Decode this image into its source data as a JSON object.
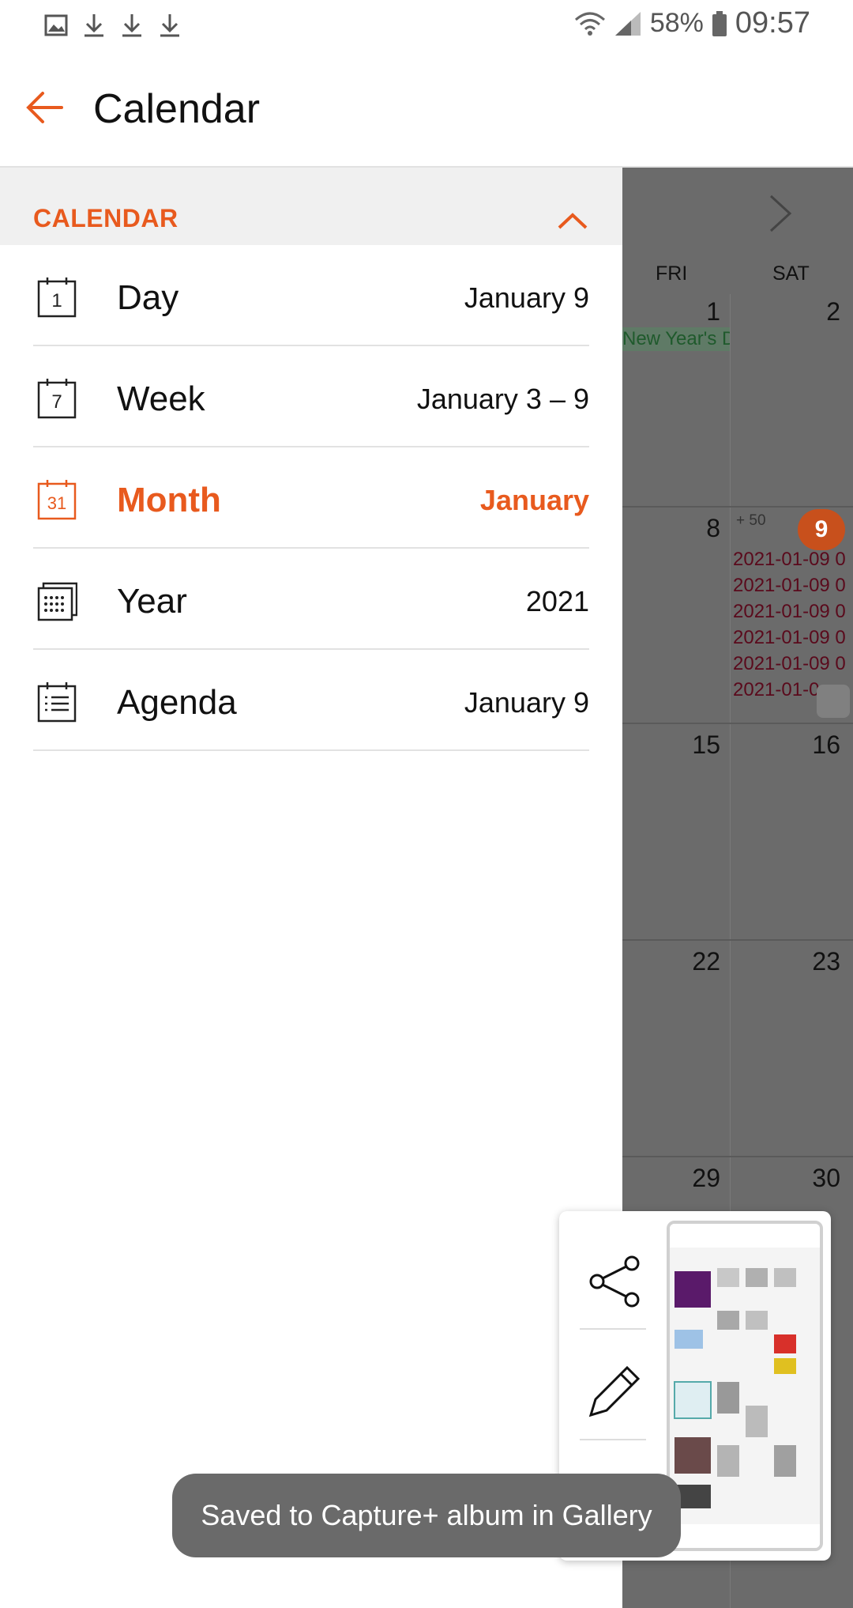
{
  "status_bar": {
    "icons_left": [
      "gallery-icon",
      "download-icon",
      "download-icon",
      "download-icon"
    ],
    "battery_percent": "58%",
    "time": "09:57"
  },
  "app_bar": {
    "title": "Calendar"
  },
  "drawer": {
    "section_title": "CALENDAR",
    "items": [
      {
        "label": "Day",
        "value": "January 9",
        "icon_text": "1"
      },
      {
        "label": "Week",
        "value": "January 3 – 9",
        "icon_text": "7"
      },
      {
        "label": "Month",
        "value": "January",
        "icon_text": "31"
      },
      {
        "label": "Year",
        "value": "2021"
      },
      {
        "label": "Agenda",
        "value": "January 9"
      }
    ]
  },
  "calendar_bg": {
    "days_of_week": [
      "FRI",
      "SAT"
    ],
    "dates": [
      "1",
      "2",
      "8",
      "9",
      "15",
      "16",
      "22",
      "23",
      "29",
      "30"
    ],
    "holiday": "New Year's D",
    "more_count": "+ 50",
    "events": [
      "2021-01-09 0",
      "2021-01-09 0",
      "2021-01-09 0",
      "2021-01-09 0",
      "2021-01-09 0",
      "2021-01-0"
    ]
  },
  "toast": {
    "text": "Saved to Capture+ album in Gallery"
  },
  "colors": {
    "accent": "#e85a1e",
    "overlay": "#6b6b6b",
    "today": "#c8501c"
  }
}
